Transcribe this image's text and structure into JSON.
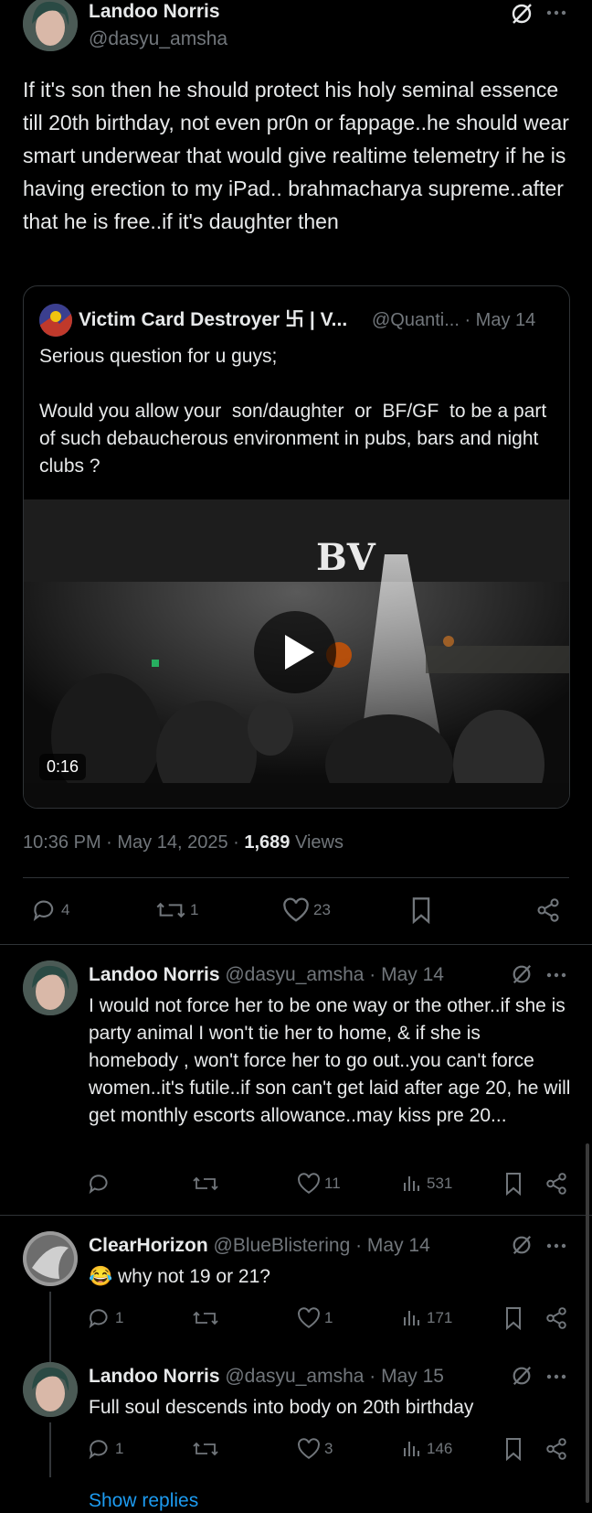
{
  "main_tweet": {
    "author_name": "Landoo Norris",
    "author_handle": "@dasyu_amsha",
    "body": "If it's son then he should protect his holy seminal essence till 20th birthday, not even pr0n or fappage..he should wear smart underwear that would give realtime telemetry if he is having erection to my iPad.. brahmacharya supreme..after that he is free..if it's daughter then",
    "timestamp": "10:36 PM · May 14, 2025 · ",
    "views_count": "1,689",
    "views_label": " Views",
    "replies": "4",
    "reposts": "1",
    "likes": "23"
  },
  "quoted_tweet": {
    "author_name": "Victim Card Destroyer 卐 | V...",
    "author_handle": "@Quanti... · May 14",
    "line1": "Serious question for u guys;",
    "line2": "Would you allow your  son/daughter  or  BF/GF  to be a part of such debaucherous environment in pubs, bars and night clubs ?",
    "video_duration": "0:16",
    "video_sign_text": "BV"
  },
  "replies": [
    {
      "author_name": "Landoo Norris",
      "author_handle": "@dasyu_amsha · May 14",
      "body": "I would not force her to be one way or the other..if she is party animal I won't tie her to home, & if she is homebody , won't force her to go out..you can't force women..it's futile..if son can't get laid after age 20, he will get monthly escorts allowance..may kiss pre 20...",
      "replies": "",
      "reposts": "",
      "likes": "11",
      "views": "531"
    },
    {
      "author_name": "ClearHorizon",
      "author_handle": "@BlueBlistering · May 14",
      "emoji": "😂",
      "body": " why not 19 or 21?",
      "replies": "1",
      "reposts": "",
      "likes": "1",
      "views": "171"
    },
    {
      "author_name": "Landoo Norris",
      "author_handle": "@dasyu_amsha · May 15",
      "body": "Full soul descends into body on 20th birthday",
      "replies": "1",
      "reposts": "",
      "likes": "3",
      "views": "146"
    }
  ],
  "show_replies_label": "Show replies",
  "colors": {
    "background": "#000000",
    "text": "#e7e9ea",
    "muted": "#71767b",
    "link": "#1d9bf0",
    "border": "#2f3336"
  }
}
